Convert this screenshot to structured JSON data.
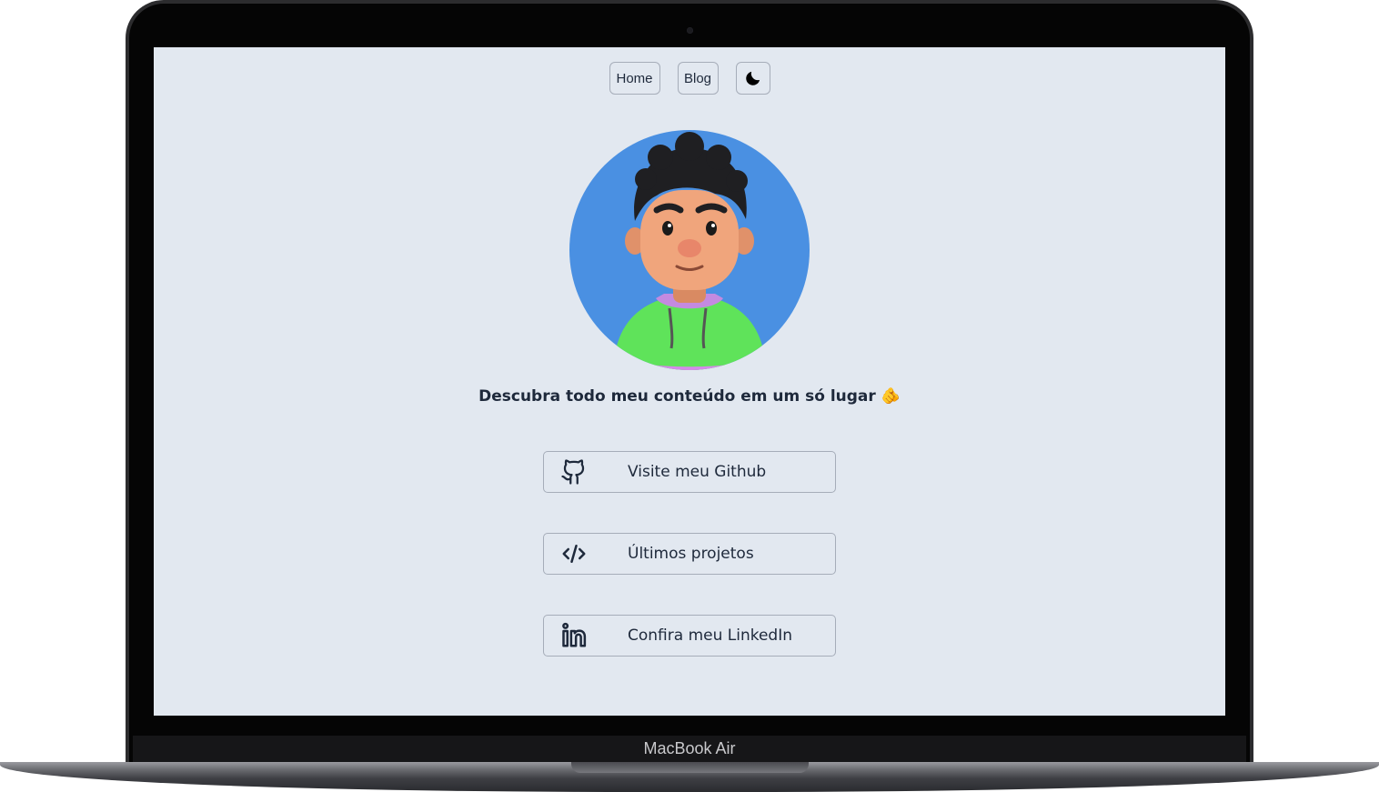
{
  "device": {
    "brand_label": "MacBook Air"
  },
  "nav": {
    "home_label": "Home",
    "blog_label": "Blog",
    "theme_icon": "moon-icon"
  },
  "profile": {
    "avatar": "avatar-3d-character",
    "tagline": "Descubra todo meu conteúdo em um só lugar 🫵"
  },
  "links": [
    {
      "label": "Visite meu Github",
      "icon": "github-icon"
    },
    {
      "label": "Últimos projetos",
      "icon": "code-icon"
    },
    {
      "label": "Confira meu LinkedIn",
      "icon": "linkedin-icon"
    }
  ],
  "colors": {
    "screen_background": "#e2e8f0",
    "avatar_background": "#4a90e2",
    "text": "#1e293b",
    "border": "#a6adb9"
  }
}
